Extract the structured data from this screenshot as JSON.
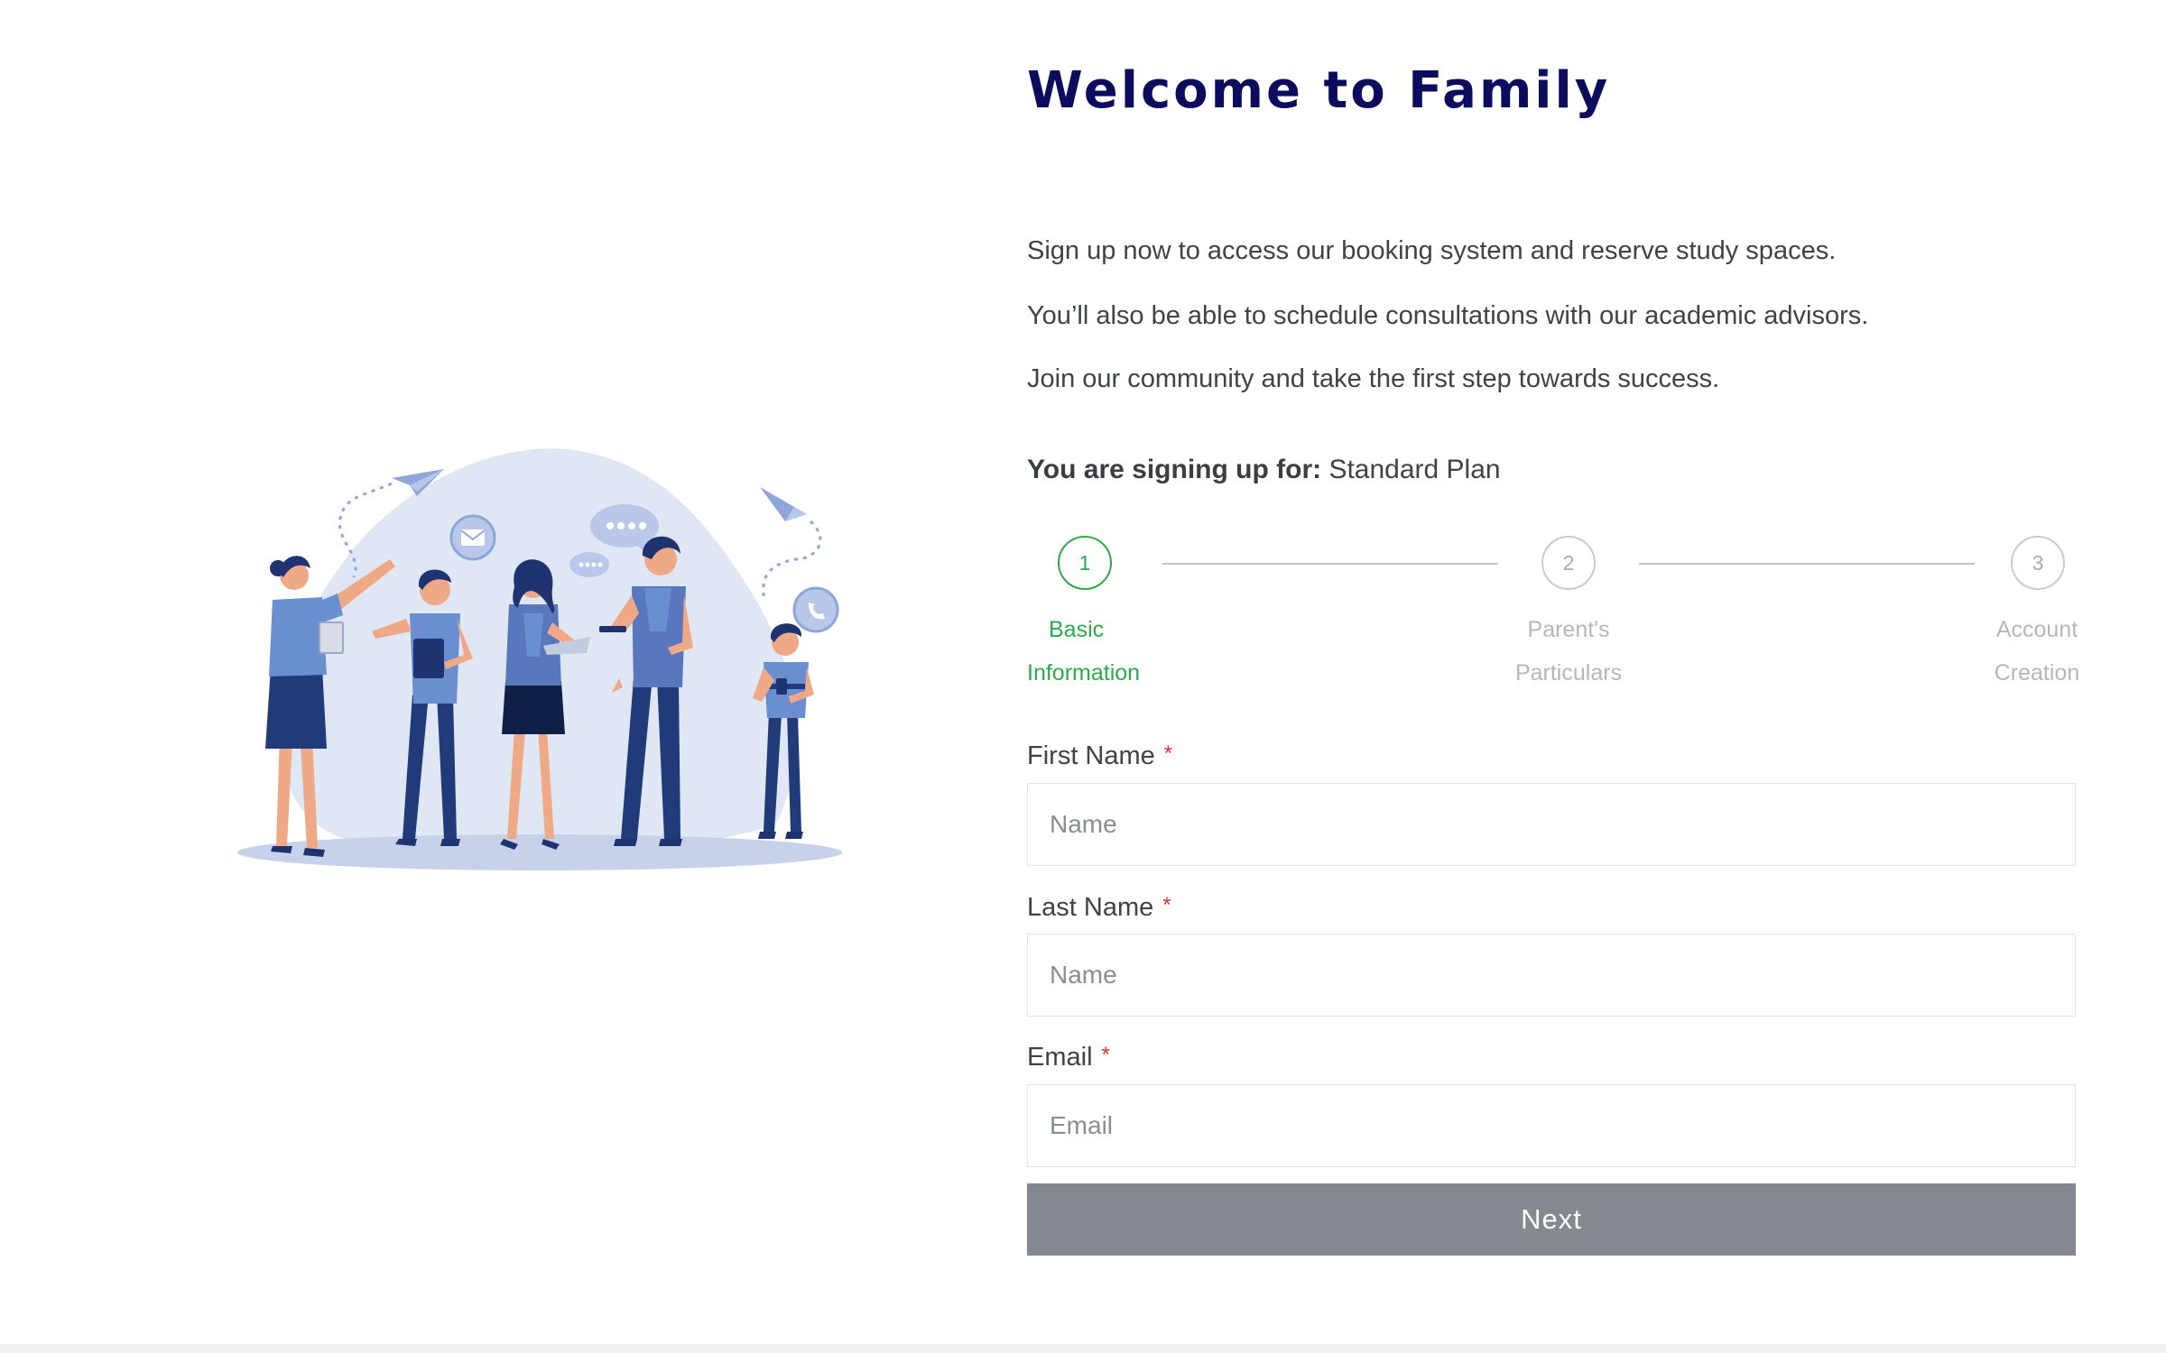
{
  "header": {
    "title": "Welcome to Family"
  },
  "intro": {
    "line1": "Sign up now to access our booking system and reserve study spaces.",
    "line2": "You’ll also be able to schedule consultations with our academic advisors.",
    "line3": "Join our community and take the first step towards success."
  },
  "plan": {
    "label": "You are signing up for:",
    "value": "Standard Plan"
  },
  "stepper": {
    "steps": [
      {
        "number": "1",
        "line1": "Basic",
        "line2": "Information",
        "state": "active"
      },
      {
        "number": "2",
        "line1": "Parent's",
        "line2": "Particulars",
        "state": "inactive"
      },
      {
        "number": "3",
        "line1": "Account",
        "line2": "Creation",
        "state": "inactive"
      }
    ]
  },
  "form": {
    "first_name": {
      "label": "First Name",
      "required_mark": "*",
      "placeholder": "Name",
      "value": ""
    },
    "last_name": {
      "label": "Last Name",
      "required_mark": "*",
      "placeholder": "Name",
      "value": ""
    },
    "email": {
      "label": "Email",
      "required_mark": "*",
      "placeholder": "Email",
      "value": ""
    },
    "next_label": "Next"
  },
  "colors": {
    "title": "#0c0c5e",
    "active_step": "#2cab4b",
    "required": "#e0322f",
    "button": "#83898f",
    "illustration_blob": "#dfe6f4",
    "illustration_blue": "#6a8fd0",
    "illustration_navy": "#1f3370"
  },
  "illustration": {
    "icons": [
      "paper-plane-icon",
      "envelope-icon",
      "chat-bubble-icon",
      "phone-icon"
    ]
  }
}
